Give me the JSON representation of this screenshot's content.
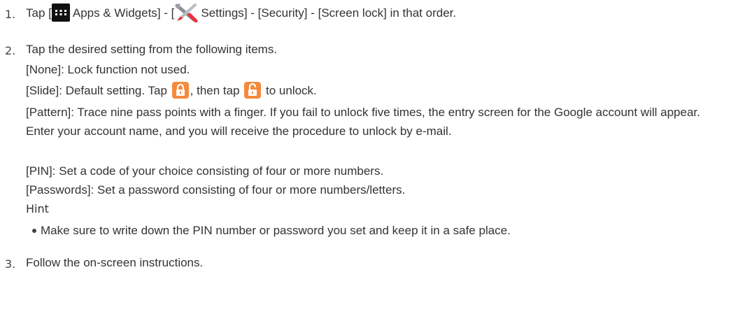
{
  "steps": [
    {
      "num": "1.",
      "parts": {
        "t1": "Tap [",
        "apps_label": "Apps & Widgets",
        "t2": "] - [",
        "settings_label": "Settings",
        "t3": "] - [Security] - [Screen lock] in that order."
      }
    },
    {
      "num": "2.",
      "intro": "Tap the desired setting from the following items.",
      "items": {
        "none": "[None]: Lock function not used.",
        "slide_a": "[Slide]: Default setting. Tap",
        "slide_b": ", then tap",
        "slide_c": "to unlock.",
        "pattern": "[Pattern]: Trace nine pass points with a finger. If you fail to unlock five times, the entry screen for the Google account will appear. Enter your account name, and you will receive the procedure to unlock by e-mail.",
        "pin": "[PIN]: Set a code of your choice consisting of four or more numbers.",
        "passwords": "[Passwords]: Set a password consisting of four or more numbers/letters."
      },
      "hint_title": "Hint",
      "hint_text": "Make sure to write down the PIN number or password you set and keep it in a safe place."
    },
    {
      "num": "3.",
      "text": "Follow the on-screen instructions."
    }
  ],
  "icons": {
    "apps": "apps-grid-icon",
    "settings": "wrench-screwdriver-icon",
    "lock": "padlock-closed-icon",
    "unlock": "padlock-open-icon"
  },
  "colors": {
    "lock_orange": "#f58a3c",
    "apps_black": "#111111"
  }
}
